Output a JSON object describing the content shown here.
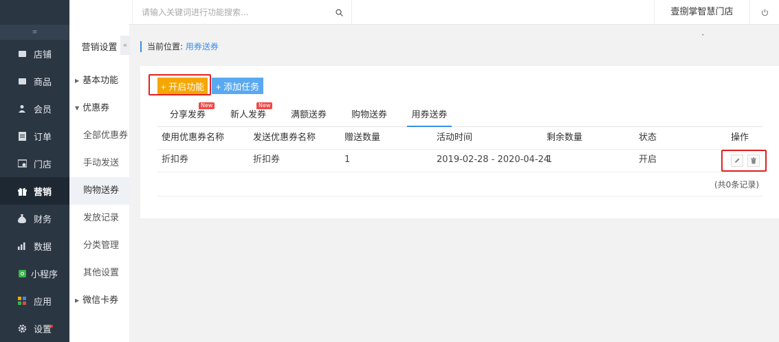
{
  "sidebar": {
    "toggle": "≡",
    "items": [
      {
        "label": "店铺",
        "icon": "store-icon"
      },
      {
        "label": "商品",
        "icon": "goods-icon"
      },
      {
        "label": "会员",
        "icon": "member-icon"
      },
      {
        "label": "订单",
        "icon": "order-icon"
      },
      {
        "label": "门店",
        "icon": "shop-icon"
      },
      {
        "label": "营销",
        "icon": "gift-icon",
        "active": true
      },
      {
        "label": "财务",
        "icon": "finance-icon"
      },
      {
        "label": "数据",
        "icon": "data-icon"
      },
      {
        "label": "小程序",
        "icon": "miniapp-icon"
      },
      {
        "label": "应用",
        "icon": "apps-icon"
      },
      {
        "label": "设置",
        "icon": "gear-icon"
      }
    ]
  },
  "submenu": {
    "title": "营销设置",
    "collapse": "«",
    "items": [
      {
        "label": "基本功能",
        "group": true,
        "expanded": false
      },
      {
        "label": "优惠券",
        "group": true,
        "expanded": true
      },
      {
        "label": "全部优惠券"
      },
      {
        "label": "手动发送"
      },
      {
        "label": "购物送券",
        "active": true
      },
      {
        "label": "发放记录"
      },
      {
        "label": "分类管理"
      },
      {
        "label": "其他设置"
      },
      {
        "label": "微信卡券",
        "group": true,
        "expanded": false
      }
    ]
  },
  "topbar": {
    "search_placeholder": "请输入关键词进行功能搜索...",
    "store_name": "壹捌掌智慧门店"
  },
  "breadcrumb": {
    "prefix": "当前位置:",
    "current": "用券送券"
  },
  "toolbar": {
    "open_label": "+ 开启功能",
    "add_label": "+ 添加任务"
  },
  "tabs": [
    {
      "label": "分享发券",
      "badge": "New"
    },
    {
      "label": "新人发券",
      "badge": "New"
    },
    {
      "label": "满额送券"
    },
    {
      "label": "购物送券"
    },
    {
      "label": "用券送券",
      "active": true
    }
  ],
  "table": {
    "headers": [
      "使用优惠券名称",
      "发送优惠券名称",
      "赠送数量",
      "活动时间",
      "剩余数量",
      "状态",
      "操作"
    ],
    "rows": [
      [
        "折扣券",
        "折扣券",
        "1",
        "2019-02-28 - 2020-04-24",
        "1",
        "开启"
      ]
    ],
    "record_text": "(共0条记录)"
  },
  "colors": {
    "sidebar_bg": "#2b3643",
    "accent": "#3a8ee6",
    "orange": "#f5a600",
    "blue_button": "#5aa9f0",
    "highlight_red": "#e02020"
  }
}
